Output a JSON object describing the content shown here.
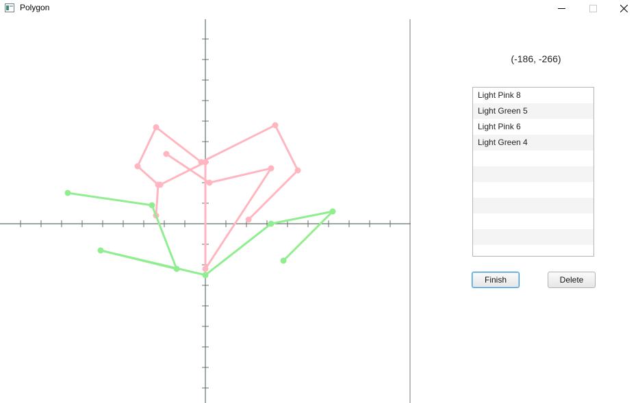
{
  "window": {
    "title": "Polygon",
    "icon": "app-window-icon",
    "controls": [
      "minimize-icon",
      "maximize-icon",
      "close-icon"
    ]
  },
  "coordinate_readout": "(-186, -266)",
  "polygon_list": {
    "items": [
      "Light Pink 8",
      "Light Green 5",
      "Light Pink 6",
      "Light Green 4"
    ],
    "empty_rows": 7
  },
  "buttons": {
    "finish": "Finish",
    "delete": "Delete"
  },
  "colors": {
    "axis": "#5f7169",
    "light_pink": "#ffb6c1",
    "light_green": "#90ee90",
    "focus_border": "#3b99d9"
  },
  "polygons": [
    {
      "label": "Light Pink 8",
      "color": "#ffb6c1",
      "points": [
        [
          -24,
          4
        ],
        [
          -23,
          19
        ],
        [
          -33,
          28
        ],
        [
          -24,
          47
        ],
        [
          -2,
          30
        ],
        [
          34,
          48
        ],
        [
          45,
          26
        ],
        [
          21,
          2
        ]
      ]
    },
    {
      "label": "Light Green 5",
      "color": "#90ee90",
      "points": [
        [
          -67,
          15
        ],
        [
          -26,
          9
        ],
        [
          -14,
          -22
        ],
        [
          -51,
          -13
        ],
        [
          0,
          -25
        ]
      ]
    },
    {
      "label": "Light Pink 6",
      "color": "#ffb6c1",
      "points": [
        [
          -19,
          34
        ],
        [
          2,
          20
        ],
        [
          32,
          27
        ],
        [
          0,
          -22
        ],
        [
          0,
          30
        ],
        [
          -22,
          19
        ]
      ]
    },
    {
      "label": "Light Green 4",
      "color": "#90ee90",
      "points": [
        [
          0,
          -25
        ],
        [
          32,
          0
        ],
        [
          62,
          6
        ],
        [
          38,
          -18
        ]
      ]
    }
  ]
}
